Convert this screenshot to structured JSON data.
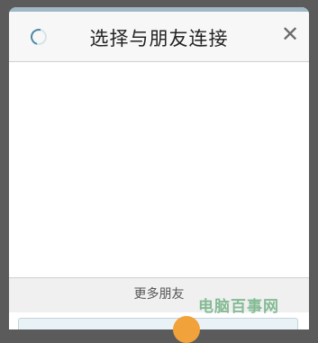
{
  "dialog": {
    "title": "选择与朋友连接",
    "close_icon": "close-icon",
    "spinner_icon": "loading-spinner-icon"
  },
  "footer": {
    "more_friends_label": "更多朋友"
  },
  "watermark": {
    "text": "电脑百事网"
  },
  "colors": {
    "backdrop": "#5b5b5b",
    "accent": "#9eb9c4",
    "spinner": "#4b88a6",
    "watermark_orange": "#f2a23a"
  }
}
